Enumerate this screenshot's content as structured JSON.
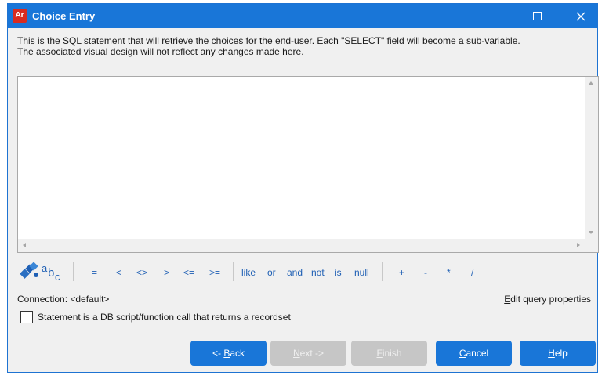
{
  "window": {
    "title": "Choice Entry",
    "app_icon_text": "Ar"
  },
  "description": {
    "line1": "This is the SQL statement that will retrieve the choices for the end-user.  Each \"SELECT\" field will become a sub-variable.",
    "line2": " The associated visual design will not reflect any changes made here."
  },
  "editor": {
    "value": ""
  },
  "toolbar": {
    "icon_text": "abc",
    "operators_compare": [
      "=",
      "<",
      "<>",
      ">",
      "<=",
      ">="
    ],
    "operators_logic": [
      "like",
      "or",
      "and",
      "not",
      "is",
      "null"
    ],
    "operators_math": [
      "+",
      "-",
      "*",
      "/"
    ]
  },
  "connection": {
    "label": "Connection: <default>"
  },
  "edit_query": {
    "label_first": "E",
    "label_rest": "dit query properties"
  },
  "checkbox": {
    "label": "Statement is a DB script/function call that returns a recordset",
    "checked": false
  },
  "buttons": {
    "back": {
      "prefix": "<- ",
      "underline": "B",
      "rest": "ack"
    },
    "next": {
      "underline": "N",
      "rest": "ext ->"
    },
    "finish": {
      "underline": "F",
      "rest": "inish"
    },
    "cancel": {
      "underline": "C",
      "rest": "ancel"
    },
    "help": {
      "underline": "H",
      "rest": "elp"
    }
  },
  "colors": {
    "titlebar": "#1976d8",
    "button_active": "#1976d8",
    "button_disabled": "#c6c6c6",
    "operator_text": "#1e5fb4"
  }
}
